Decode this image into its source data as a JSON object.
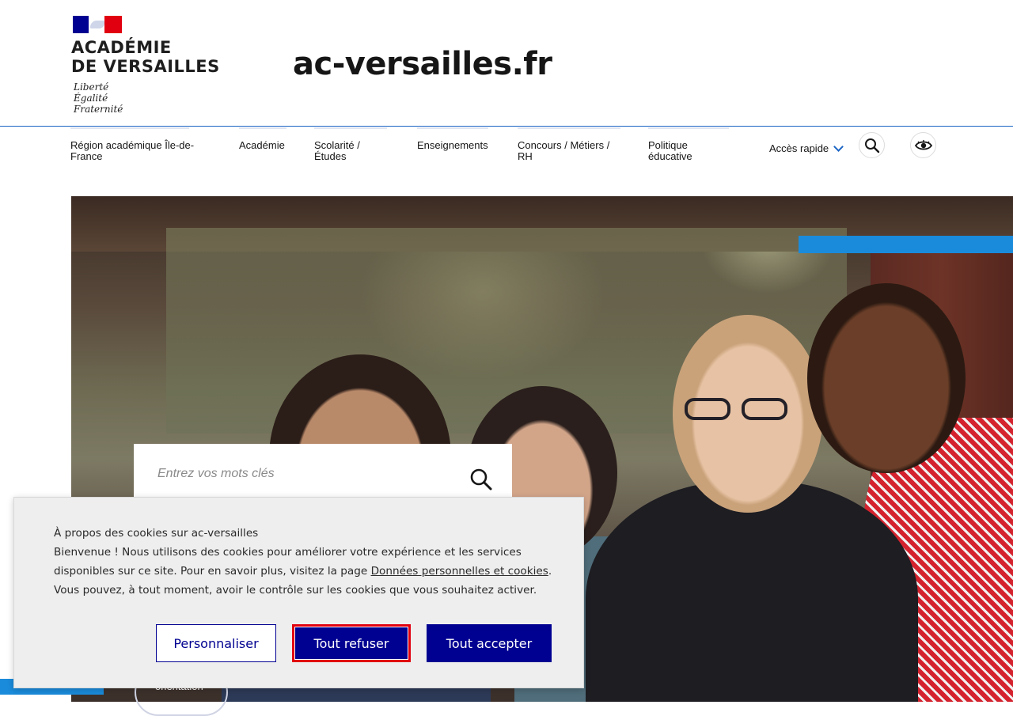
{
  "header": {
    "logo": {
      "line1": "ACADÉMIE",
      "line2": "DE VERSAILLES",
      "motto": [
        "Liberté",
        "Égalité",
        "Fraternité"
      ]
    },
    "site_title": "ac-versailles.fr"
  },
  "nav": {
    "items": [
      {
        "label": "Région académique Île-de-France"
      },
      {
        "label": "Académie"
      },
      {
        "label": "Scolarité / Études"
      },
      {
        "label": "Enseignements"
      },
      {
        "label": "Concours / Métiers / RH"
      },
      {
        "label": "Politique éducative"
      }
    ],
    "quick_access": "Accès rapide",
    "search_icon": "search-icon",
    "accessibility_icon": "eye-icon"
  },
  "search": {
    "placeholder": "Entrez vos mots clés"
  },
  "hero": {
    "orientation_label": "orientation"
  },
  "cookie_banner": {
    "title": "À propos des cookies sur ac-versailles",
    "body_before_link": "Bienvenue ! Nous utilisons des cookies pour améliorer votre expérience et les services disponibles sur ce site. Pour en savoir plus, visitez la page ",
    "link_text": "Données personnelles et cookies",
    "body_after_link": ". Vous pouvez, à tout moment, avoir le contrôle sur les cookies que vous souhaitez activer.",
    "buttons": {
      "customize": "Personnaliser",
      "refuse_all": "Tout refuser",
      "accept_all": "Tout accepter"
    }
  },
  "colors": {
    "primary": "#000091",
    "accent_blue": "#1a8bdb",
    "focus_red": "#e1000f",
    "banner_bg": "#eeeeee"
  }
}
